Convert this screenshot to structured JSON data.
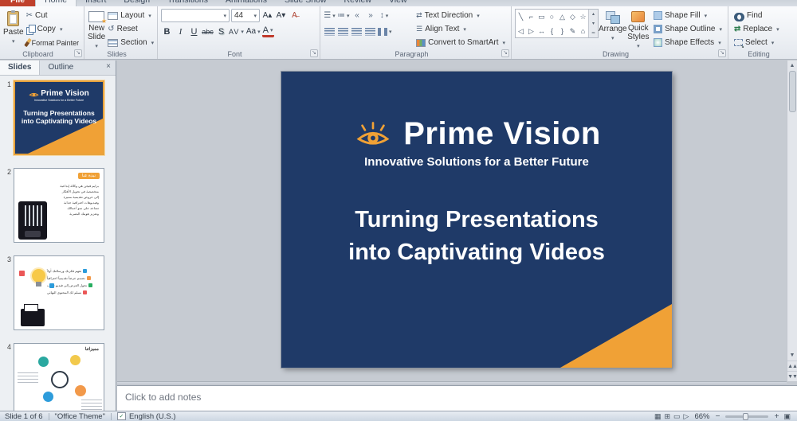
{
  "colors": {
    "navy": "#1F3A68",
    "orange": "#F0A136"
  },
  "ribbon": {
    "tabs": [
      "File",
      "Home",
      "Insert",
      "Design",
      "Transitions",
      "Animations",
      "Slide Show",
      "Review",
      "View"
    ],
    "clipboard": {
      "label": "Clipboard",
      "paste": "Paste",
      "cut": "Cut",
      "copy": "Copy",
      "format_painter": "Format Painter"
    },
    "slides": {
      "label": "Slides",
      "new_slide": "New Slide",
      "layout": "Layout",
      "reset": "Reset",
      "section": "Section"
    },
    "font": {
      "label": "Font",
      "font_name": "",
      "size_value": "44",
      "bold": "B",
      "italic": "I",
      "underline": "U",
      "strike": "abc",
      "shadow": "S",
      "spacing": "AV",
      "case_btn": "Aa",
      "color_btn": "A",
      "grow": "A▴",
      "shrink": "A▾"
    },
    "paragraph": {
      "label": "Paragraph",
      "text_direction": "Text Direction",
      "align_text": "Align Text",
      "convert_smartart": "Convert to SmartArt"
    },
    "drawing": {
      "label": "Drawing",
      "arrange": "Arrange",
      "quick_styles": "Quick Styles",
      "shape_fill": "Shape Fill",
      "shape_outline": "Shape Outline",
      "shape_effects": "Shape Effects",
      "shapes1": [
        "╲",
        "⌐",
        "▭",
        "○",
        "△",
        "◇",
        "☆"
      ],
      "shapes2": [
        "◁",
        "▷",
        "↔",
        "{",
        "}",
        "✎",
        "⌂"
      ]
    },
    "editing": {
      "label": "Editing",
      "find": "Find",
      "replace": "Replace",
      "select": "Select"
    }
  },
  "left_panel": {
    "tab_slides": "Slides",
    "tab_outline": "Outline",
    "close": "×",
    "thumbnails": [
      {
        "num": "1",
        "brand": "Prime Vision",
        "tagline": "Innovative Solutions for a Better Future",
        "heading": "Turning Presentations into Captivating Videos"
      },
      {
        "num": "2",
        "tag": "نبذة عنا",
        "lines": [
          "برايم فيجن هي وكالة إبداعية",
          "متخصصة في تحويل الأفكار",
          "إلى عروض تقديمية مميزة",
          "وفيديوهات احترافية جذابة",
          "تساعد على نمو أعمالك",
          "وتعزيز هويتك البصرية"
        ]
      },
      {
        "num": "3",
        "items": [
          "نفهم فكرتك ورسالتك أولاً",
          "نصمم عرضاً تقديمياً احترافياً",
          "نحول العرض إلى فيديو جذاب",
          "نسلم لك المحتوى النهائي"
        ]
      },
      {
        "num": "4",
        "center": "مميزاتنا"
      }
    ]
  },
  "slide": {
    "brand": "Prime Vision",
    "tagline": "Innovative Solutions for a Better Future",
    "title_line1": "Turning Presentations",
    "title_line2": "into Captivating Videos"
  },
  "notes": {
    "placeholder": "Click to add notes"
  },
  "status": {
    "slide_info": "Slide 1 of 6",
    "theme": "\"Office Theme\"",
    "language": "English (U.S.)",
    "zoom": "66%",
    "zoom_out": "−",
    "zoom_in": "+"
  }
}
